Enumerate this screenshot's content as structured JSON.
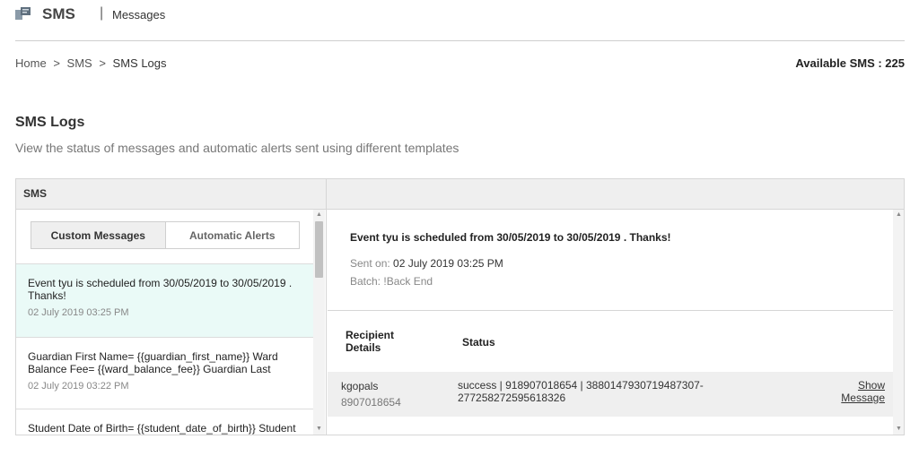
{
  "header": {
    "title": "SMS",
    "separator": "|",
    "subtitle": "Messages",
    "icon": "sms-app-icon"
  },
  "breadcrumb": [
    "Home",
    ">",
    "SMS",
    ">",
    "SMS Logs"
  ],
  "available_sms": "Available SMS : 225",
  "page": {
    "title": "SMS Logs",
    "description": "View the status of messages and automatic alerts sent using different templates"
  },
  "panel": {
    "header_label": "SMS",
    "tabs": [
      "Custom Messages",
      "Automatic Alerts"
    ],
    "active_tab": "Custom Messages",
    "messages": [
      {
        "text": "Event tyu is scheduled from 30/05/2019 to 30/05/2019 . Thanks!",
        "time": "02 July 2019 03:25 PM"
      },
      {
        "text": "Guardian First Name= {{guardian_first_name}} Ward Balance Fee= {{ward_balance_fee}} Guardian Last",
        "time": "02 July 2019 03:22 PM"
      },
      {
        "text": "Student Date of Birth= {{student_date_of_birth}} Student",
        "time": ""
      }
    ]
  },
  "detail": {
    "title": "Event tyu is scheduled from 30/05/2019 to 30/05/2019 . Thanks!",
    "sent_label": "Sent on:",
    "sent_value": "02 July 2019 03:25 PM",
    "batch": "Batch: !Back End",
    "columns": [
      "Recipient Details",
      "Status"
    ],
    "rows": [
      {
        "name": "kgopals",
        "phone": "8907018654",
        "status": "success | 918907018654 | 3880147930719487307-277258272595618326",
        "action": "Show Message"
      }
    ]
  },
  "colors": {
    "selected_row": "#eafaf7",
    "panel_header": "#efefef",
    "border": "#d6d6d6"
  }
}
